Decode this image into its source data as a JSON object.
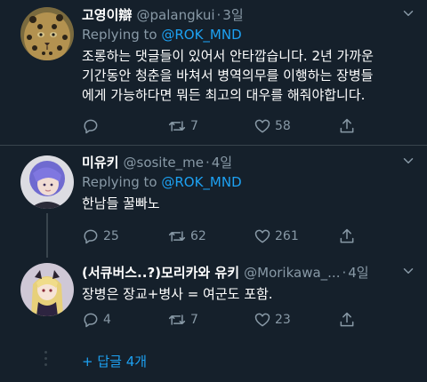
{
  "tweets": [
    {
      "name": "고영이辯",
      "handle": "@palangkui",
      "time": "3일",
      "replying_prefix": "Replying to ",
      "replying_to": "@ROK_MND",
      "lines": [
        "조롱하는 댓글들이 있어서 안타깝습니다. 2년 가까운",
        "기간동안 청춘을 바쳐서 병역의무를 이행하는 장병들",
        "에게 가능하다면 뭐든 최고의 대우를 해줘야합니다."
      ],
      "replies": "",
      "retweets": "7",
      "likes": "58"
    },
    {
      "name": "미유키",
      "handle": "@sosite_me",
      "time": "4일",
      "replying_prefix": "Replying to ",
      "replying_to": "@ROK_MND",
      "lines": [
        "한남들 꿀빠노"
      ],
      "replies": "25",
      "retweets": "62",
      "likes": "261"
    },
    {
      "name": "(서큐버스..?)모리카와 유키",
      "handle": "@Morikawa_...",
      "time": "4일",
      "lines": [
        "장병은 장교+병사 = 여군도 포함."
      ],
      "replies": "4",
      "retweets": "7",
      "likes": "23"
    }
  ],
  "more_replies": "+ 답글 4개",
  "icons": {
    "reply": "reply-icon",
    "retweet": "retweet-icon",
    "like": "heart-icon",
    "share": "share-icon",
    "more": "chevron-down-icon"
  },
  "colors": {
    "background": "#15202b",
    "accent": "#1da1f2",
    "muted": "#8899a6",
    "divider": "#38444d"
  }
}
